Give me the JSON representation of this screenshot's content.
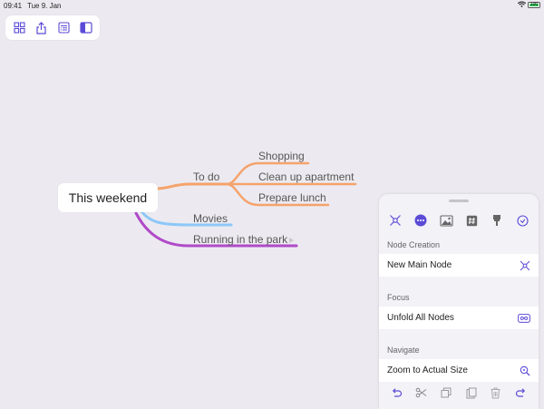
{
  "status_bar": {
    "time": "09:41",
    "date": "Tue 9. Jan",
    "battery": "100"
  },
  "toolbar": {
    "icons": [
      "grid-icon",
      "share-icon",
      "outline-icon",
      "sidebar-icon"
    ]
  },
  "mindmap": {
    "root": "This weekend",
    "branches": [
      {
        "label": "To do",
        "color": "#f5a36c",
        "children": [
          "Shopping",
          "Clean up apartment",
          "Prepare lunch"
        ]
      },
      {
        "label": "Movies",
        "color": "#8cc8f8",
        "children": []
      },
      {
        "label": "Running in the park",
        "color": "#b04ac9",
        "children": []
      }
    ]
  },
  "panel": {
    "accent": "#5b4bd6",
    "tabs": [
      "node-style-icon",
      "more-icon",
      "image-icon",
      "tag-icon",
      "brush-icon",
      "check-icon"
    ],
    "sections": [
      {
        "header": "Node Creation",
        "row": "New Main Node",
        "icon": "new-node-icon"
      },
      {
        "header": "Focus",
        "row": "Unfold All Nodes",
        "icon": "infinity-icon"
      },
      {
        "header": "Navigate",
        "row": "Zoom to Actual Size",
        "icon": "zoom-icon"
      }
    ],
    "bottom_tools": [
      "undo-icon",
      "cut-icon",
      "copy-icon",
      "paste-icon",
      "trash-icon",
      "redo-icon"
    ]
  }
}
